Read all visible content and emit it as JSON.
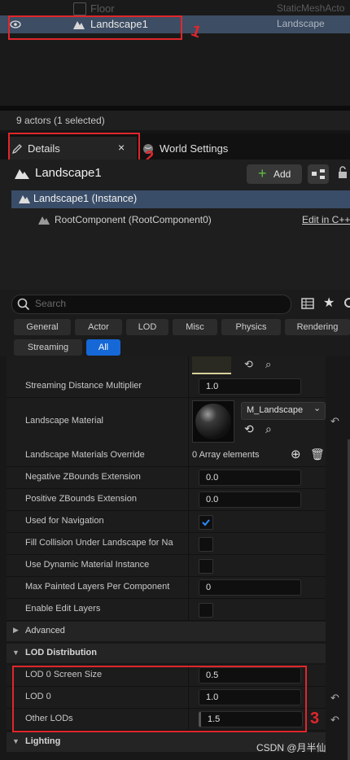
{
  "outliner": {
    "rows": [
      {
        "name": "Floor",
        "type": "StaticMeshActo"
      },
      {
        "name": "Landscape1",
        "type": "Landscape"
      }
    ],
    "status": "9 actors (1 selected)"
  },
  "tabs": {
    "details": "Details",
    "close": "×",
    "world_settings": "World Settings"
  },
  "details": {
    "title": "Landscape1",
    "add_label": "Add",
    "instance_label": "Landscape1 (Instance)",
    "root_component": "RootComponent (RootComponent0)",
    "edit_link": "Edit in C++"
  },
  "search": {
    "placeholder": "Search"
  },
  "filters": [
    "General",
    "Actor",
    "LOD",
    "Misc",
    "Physics",
    "Rendering",
    "Streaming",
    "All"
  ],
  "properties": {
    "streaming_distance": {
      "label": "Streaming Distance Multiplier",
      "value": "1.0"
    },
    "landscape_material": {
      "label": "Landscape Material",
      "value": "M_Landscape"
    },
    "materials_override": {
      "label": "Landscape Materials Override",
      "value": "0 Array elements"
    },
    "neg_zbounds": {
      "label": "Negative ZBounds Extension",
      "value": "0.0"
    },
    "pos_zbounds": {
      "label": "Positive ZBounds Extension",
      "value": "0.0"
    },
    "used_for_nav": {
      "label": "Used for Navigation",
      "checked": true
    },
    "fill_collision": {
      "label": "Fill Collision Under Landscape for Na",
      "checked": false
    },
    "dynamic_material": {
      "label": "Use Dynamic Material Instance",
      "checked": false
    },
    "max_painted": {
      "label": "Max Painted Layers Per Component",
      "value": "0"
    },
    "edit_layers": {
      "label": "Enable Edit Layers",
      "checked": false
    },
    "advanced": {
      "label": "Advanced"
    },
    "lod_distribution": {
      "label": "LOD Distribution"
    },
    "lod0_screen": {
      "label": "LOD 0 Screen Size",
      "value": "0.5"
    },
    "lod0": {
      "label": "LOD 0",
      "value": "1.0"
    },
    "other_lods": {
      "label": "Other LODs",
      "value": "1.5"
    },
    "lighting": {
      "label": "Lighting"
    }
  },
  "annotations": {
    "one": "1",
    "two": "2",
    "three": "3"
  },
  "watermark": "CSDN @月半仙",
  "colors": {
    "selection": "#3d4d63",
    "accent": "#1568d6",
    "annotation": "#e0262b",
    "check": "#2a8cff"
  }
}
